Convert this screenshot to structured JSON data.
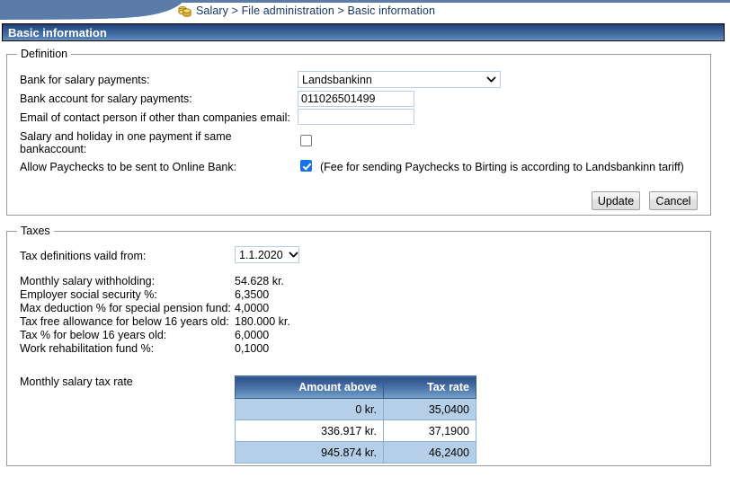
{
  "breadcrumb": {
    "icon": "coins-icon",
    "text": "Salary > File administration > Basic information"
  },
  "page": {
    "title": "Basic information"
  },
  "definition": {
    "legend": "Definition",
    "fields": {
      "bank_label": "Bank for salary payments:",
      "bank_value": "Landsbankinn",
      "account_label": "Bank account for salary payments:",
      "account_value": "011026501499",
      "email_label": "Email of contact person if other than companies email:",
      "email_value": "",
      "email_placeholder": "",
      "one_payment_label_line1": "Salary and holiday in one payment if same",
      "one_payment_label_line2": "bankaccount:",
      "one_payment_checked": false,
      "online_bank_label": "Allow Paychecks to be sent to Online Bank:",
      "online_bank_checked": true,
      "online_bank_note": "(Fee for sending Paychecks to Birting is according to Landsbankinn tariff)"
    },
    "buttons": {
      "update": "Update",
      "cancel": "Cancel"
    }
  },
  "taxes": {
    "legend": "Taxes",
    "valid_from_label": "Tax definitions vaild from:",
    "valid_from_value": "1.1.2020",
    "rows": [
      {
        "label": "Monthly salary withholding:",
        "value": "54.628 kr."
      },
      {
        "label": "Employer social security %:",
        "value": "6,3500"
      },
      {
        "label": "Max deduction % for special pension fund:",
        "value": "4,0000"
      },
      {
        "label": "Tax free allowance for below 16 years old:",
        "value": "180.000 kr."
      },
      {
        "label": "Tax % for below 16 years old:",
        "value": "6,0000"
      },
      {
        "label": "Work rehabilitation fund %:",
        "value": "0,1000"
      }
    ],
    "table_caption": "Monthly salary tax rate",
    "table": {
      "headers": [
        "Amount above",
        "Tax rate"
      ],
      "rows": [
        [
          "0 kr.",
          "35,0400"
        ],
        [
          "336.917 kr.",
          "37,1900"
        ],
        [
          "945.874 kr.",
          "46,2400"
        ]
      ]
    }
  },
  "colors": {
    "banner_blue": "#5b7ba9",
    "title_bar_dark": "#1f3c6e",
    "title_bar_light": "#6f97c4",
    "table_header_dark": "#2d5086",
    "table_row_alt": "#b5cfe8",
    "breadcrumb_text": "#16335c",
    "checkbox_checked": "#1673e6"
  }
}
